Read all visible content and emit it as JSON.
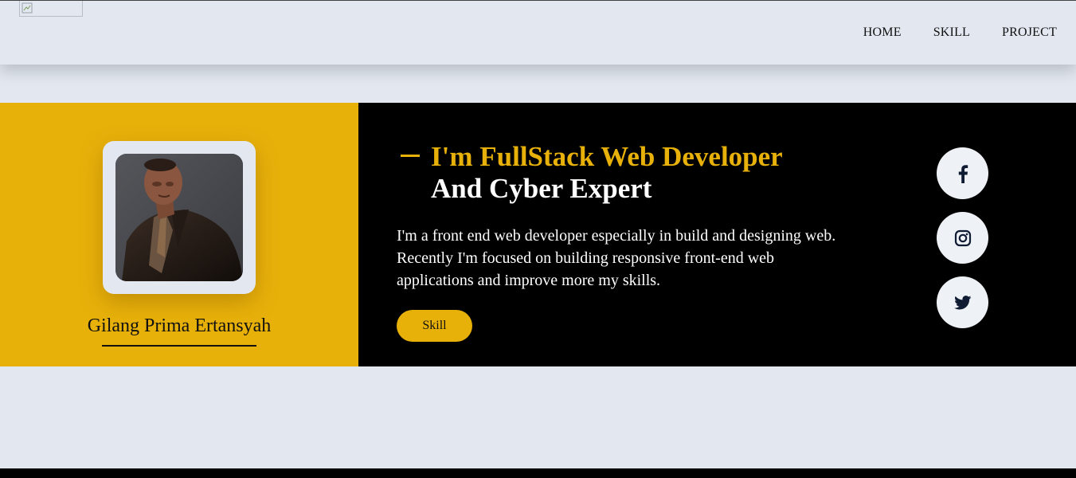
{
  "nav": {
    "items": [
      {
        "label": "HOME"
      },
      {
        "label": "SKILL"
      },
      {
        "label": "PROJECT"
      }
    ]
  },
  "profile": {
    "name": "Gilang Prima Ertansyah"
  },
  "intro": {
    "title_line1": "I'm FullStack Web Developer",
    "title_line2": "And Cyber Expert",
    "description": "I'm a front end web developer especially in build and designing web. Recently I'm focused on building responsive front-end web applications and improve more my skills.",
    "button_label": "Skill"
  },
  "social": [
    {
      "icon": "facebook-icon"
    },
    {
      "icon": "instagram-icon"
    },
    {
      "icon": "twitter-icon"
    }
  ],
  "colors": {
    "accent": "#e8b10a",
    "background": "#e2e7f0",
    "dark": "#000000"
  }
}
